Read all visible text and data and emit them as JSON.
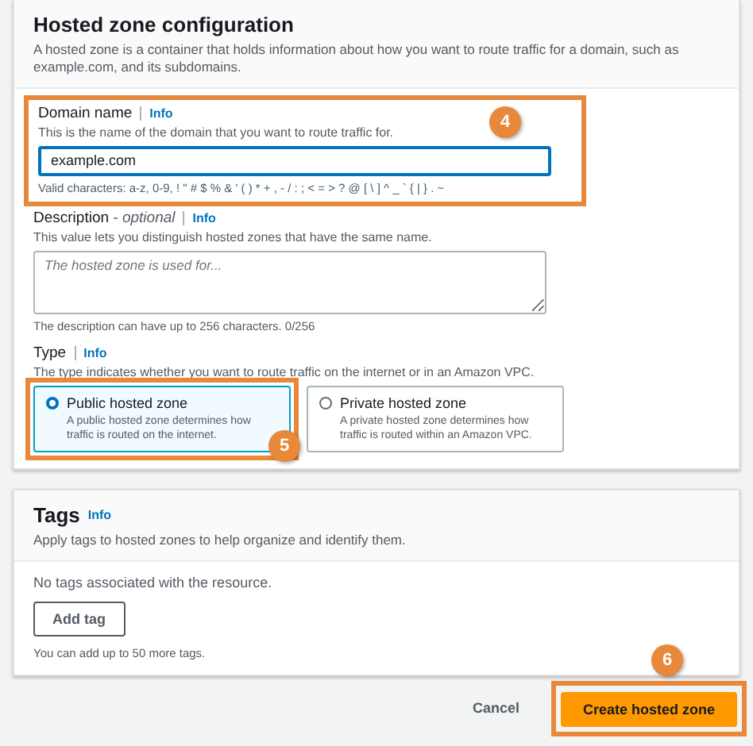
{
  "config": {
    "title": "Hosted zone configuration",
    "description": "A hosted zone is a container that holds information about how you want to route traffic for a domain, such as example.com, and its subdomains.",
    "domain": {
      "label": "Domain name",
      "info": "Info",
      "hint": "This is the name of the domain that you want to route traffic for.",
      "value": "example.com",
      "constraint": "Valid characters: a-z, 0-9, ! \" # $ % & ' ( ) * + , - / : ; < = > ? @ [ \\ ] ^ _ ` { | } . ~",
      "callout": "4"
    },
    "desc": {
      "label": "Description",
      "optional": "- optional",
      "info": "Info",
      "hint": "This value lets you distinguish hosted zones that have the same name.",
      "placeholder": "The hosted zone is used for...",
      "constraint": "The description can have up to 256 characters. 0/256"
    },
    "type": {
      "label": "Type",
      "info": "Info",
      "hint": "The type indicates whether you want to route traffic on the internet or in an Amazon VPC.",
      "options": [
        {
          "title": "Public hosted zone",
          "text": "A public hosted zone determines how traffic is routed on the internet.",
          "selected": true,
          "callout": "5"
        },
        {
          "title": "Private hosted zone",
          "text": "A private hosted zone determines how traffic is routed within an Amazon VPC.",
          "selected": false
        }
      ]
    }
  },
  "tags": {
    "title": "Tags",
    "info": "Info",
    "description": "Apply tags to hosted zones to help organize and identify them.",
    "empty": "No tags associated with the resource.",
    "add_button": "Add tag",
    "limit": "You can add up to 50 more tags."
  },
  "footer": {
    "cancel": "Cancel",
    "create": "Create hosted zone",
    "callout": "6"
  }
}
